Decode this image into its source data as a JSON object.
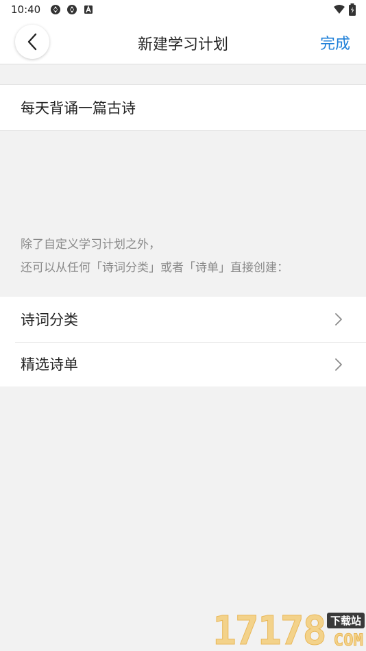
{
  "status_bar": {
    "time": "10:40",
    "icons": [
      "sync-icon",
      "sync-icon",
      "font-icon",
      "wifi-icon",
      "battery-icon"
    ]
  },
  "nav": {
    "title": "新建学习计划",
    "done_label": "完成",
    "accent_color": "#1e7fd8"
  },
  "plan_field": {
    "value": "每天背诵一篇古诗"
  },
  "hint": {
    "line1": "除了自定义学习计划之外，",
    "line2": "还可以从任何「诗词分类」或者「诗单」直接创建："
  },
  "list": {
    "items": [
      {
        "label": "诗词分类"
      },
      {
        "label": "精选诗单"
      }
    ]
  },
  "watermark": {
    "digits": "17178",
    "badge": "下载站",
    "com": "COM"
  }
}
